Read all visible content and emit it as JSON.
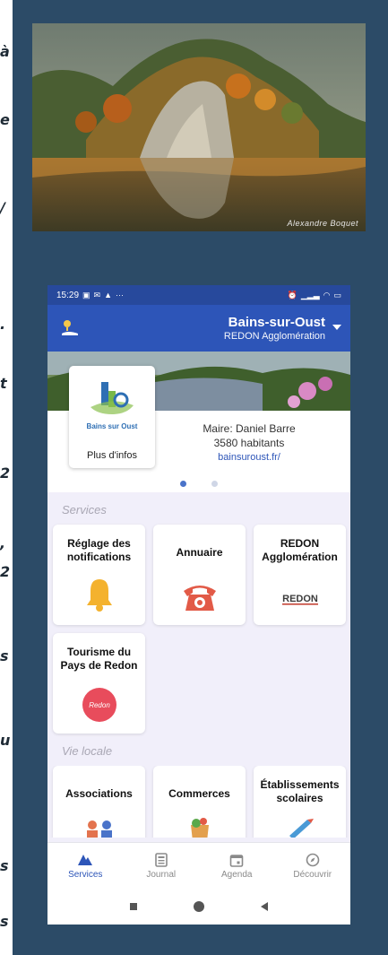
{
  "side_glyphs": [
    "à",
    "e",
    "/",
    ".",
    "t",
    "2",
    ",",
    "2",
    "s",
    "u",
    "s",
    "s"
  ],
  "photo": {
    "credit": "Alexandre Boquet"
  },
  "status_bar": {
    "time": "15:29",
    "left_extra": "···"
  },
  "app_bar": {
    "city": "Bains-sur-Oust",
    "agglomeration": "REDON Agglomération"
  },
  "city_card": {
    "logo_text": "Bains sur Oust",
    "more_info": "Plus d'infos"
  },
  "mayor": {
    "name": "Maire: Daniel Barre",
    "population": "3580 habitants",
    "website": "bainsuroust.fr/"
  },
  "sections": {
    "services": "Services",
    "vie_locale": "Vie locale"
  },
  "service_tiles": [
    {
      "label": "Réglage des notifications",
      "icon": "bell-icon"
    },
    {
      "label": "Annuaire",
      "icon": "phone-icon"
    },
    {
      "label": "REDON Agglomération",
      "icon": "redon-logo",
      "logo_text": "REDON"
    },
    {
      "label": "Tourisme du Pays de Redon",
      "icon": "tourism-logo",
      "logo_text": "Redon"
    }
  ],
  "vie_locale_tiles": [
    {
      "label": "Associations",
      "icon": "people-icon"
    },
    {
      "label": "Commerces",
      "icon": "shopping-icon"
    },
    {
      "label": "Établissements scolaires",
      "icon": "school-icon"
    }
  ],
  "bottom_nav": [
    {
      "label": "Services",
      "icon": "services-icon",
      "active": true
    },
    {
      "label": "Journal",
      "icon": "journal-icon",
      "active": false
    },
    {
      "label": "Agenda",
      "icon": "calendar-icon",
      "active": false
    },
    {
      "label": "Découvrir",
      "icon": "compass-icon",
      "active": false
    }
  ],
  "colors": {
    "primary": "#2d55b8",
    "status_bar": "#27499c",
    "panel": "#2c4b67",
    "background": "#f1effa"
  }
}
